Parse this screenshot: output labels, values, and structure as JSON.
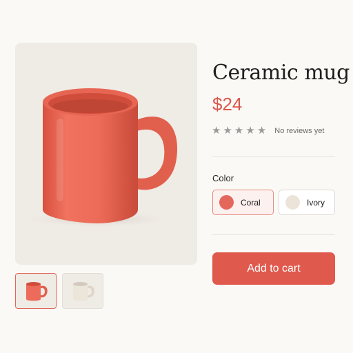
{
  "product": {
    "title": "Ceramic mug",
    "price": "$24",
    "rating": {
      "stars": 5,
      "filled": 0,
      "reviews_text": "No reviews yet"
    }
  },
  "gallery": {
    "main_image": {
      "icon": "coral-mug-image",
      "color": "#ec6b5a"
    },
    "thumbnails": [
      {
        "icon": "coral-mug-thumbnail",
        "color": "#ec6b5a",
        "selected": true
      },
      {
        "icon": "ivory-mug-thumbnail",
        "color": "#ece6da",
        "selected": false
      }
    ]
  },
  "color_picker": {
    "label": "Color",
    "options": [
      {
        "label": "Coral",
        "swatch": "#e4675b",
        "selected": true
      },
      {
        "label": "Ivory",
        "swatch": "#ece4d8",
        "selected": false
      }
    ]
  },
  "actions": {
    "add_to_cart": "Add to cart",
    "button_color": "#e0594d"
  }
}
